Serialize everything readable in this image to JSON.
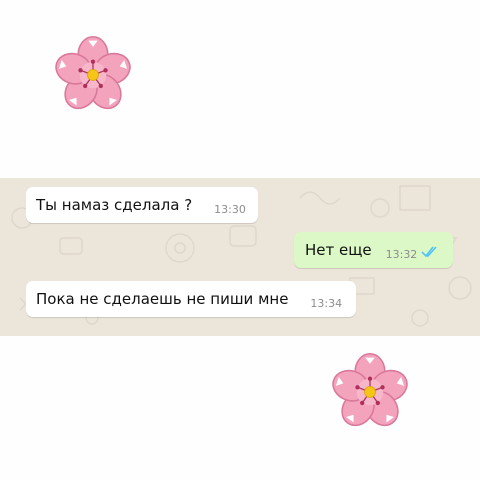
{
  "chat": {
    "messages": [
      {
        "direction": "incoming",
        "text": "Ты намаз сделала ?",
        "time": "13:30"
      },
      {
        "direction": "outgoing",
        "text": "Нет еще",
        "time": "13:32",
        "status_icon": "double-check-read-icon"
      },
      {
        "direction": "incoming",
        "text": "Пока не сделаешь не пиши мне",
        "time": "13:34"
      }
    ]
  },
  "decorations": {
    "flower_icon": "cherry-blossom-icon",
    "colors": {
      "petal": "#f4a3bd",
      "petal_shade": "#e27a9d",
      "center": "#f5c518",
      "incoming_bubble": "#ffffff",
      "outgoing_bubble": "#dcf8c6",
      "chat_background": "#ece5da",
      "read_ticks": "#4fc3f7"
    }
  }
}
